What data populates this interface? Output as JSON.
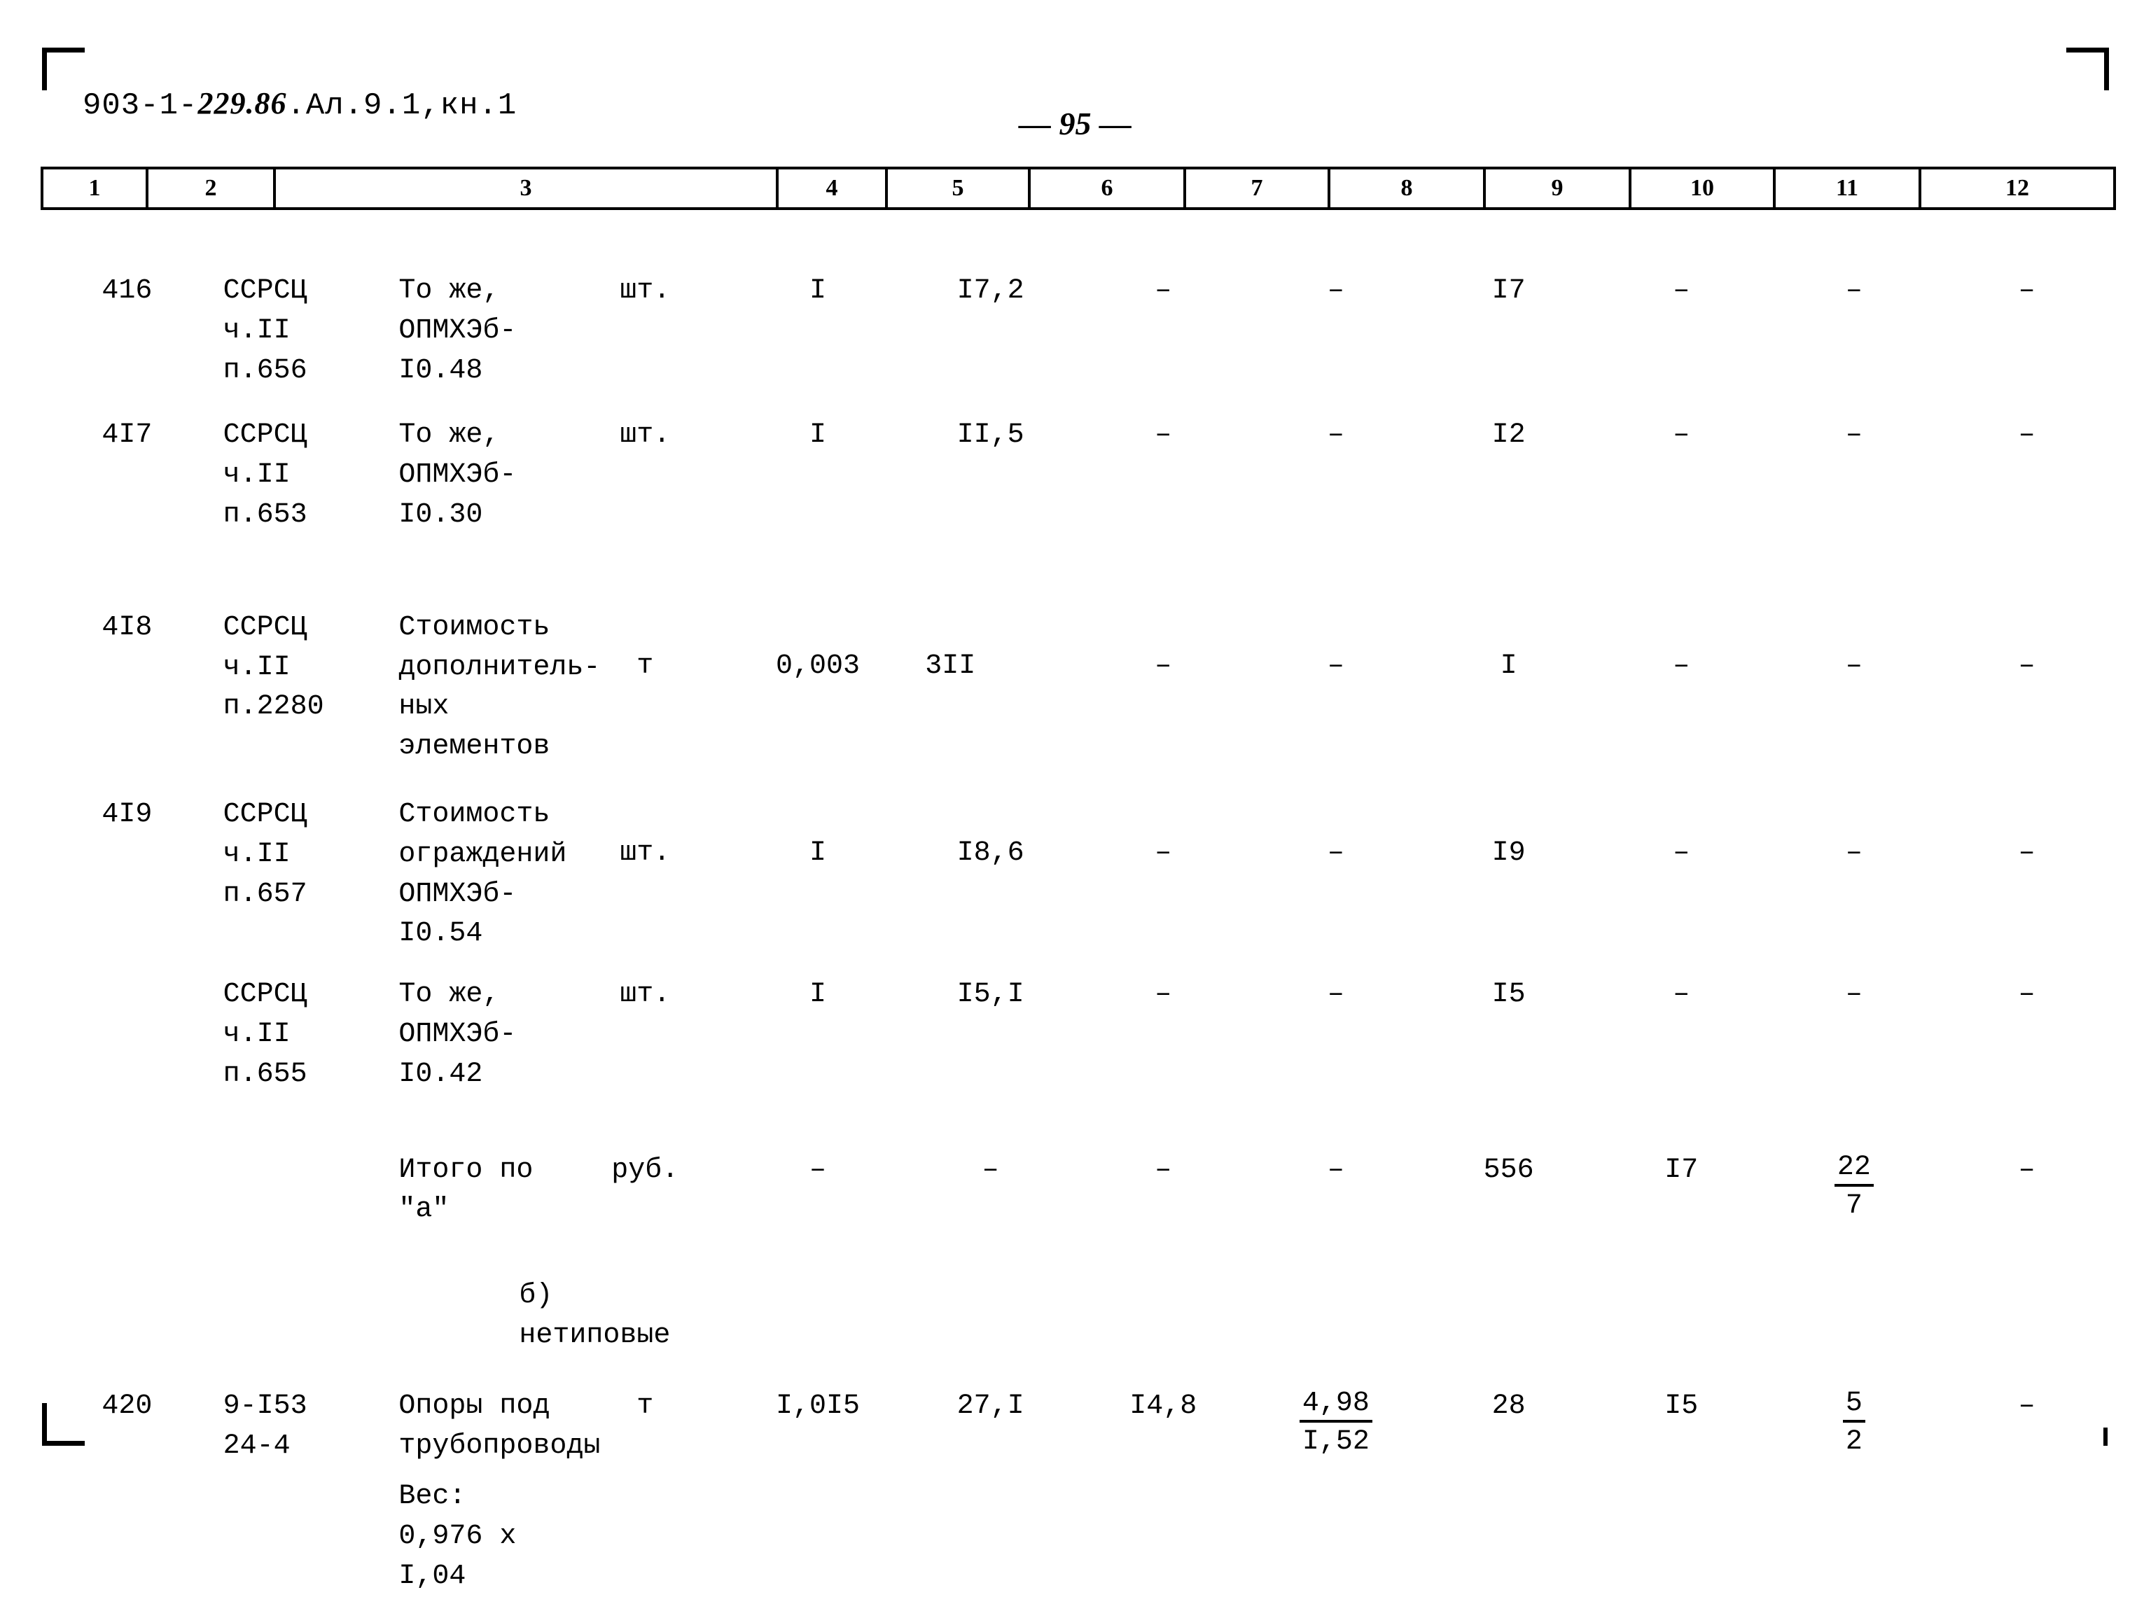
{
  "header": {
    "doc_code_prefix": "903-1-",
    "doc_code_italic": "229.86",
    "doc_code_suffix": ".Ал.9.1,кн.1",
    "page_number": "— 95 —"
  },
  "table": {
    "column_headers": [
      "1",
      "2",
      "3",
      "4",
      "5",
      "6",
      "7",
      "8",
      "9",
      "10",
      "11",
      "12"
    ],
    "rows": [
      {
        "num": "416",
        "code": "ССРСЦ\nч.II\nп.656",
        "name": "То же, ОПМХЭб-I0.48",
        "unit": "шт.",
        "c5": "I",
        "c6": "I7,2",
        "c7": "–",
        "c8": "–",
        "c9": "I7",
        "c10": "–",
        "c11": "–",
        "c12": "–"
      },
      {
        "num": "4I7",
        "code": "ССРСЦ\nч.II\nп.653",
        "name": "То же, ОПМХЭб-I0.30",
        "unit": "шт.",
        "c5": "I",
        "c6": "II,5",
        "c7": "–",
        "c8": "–",
        "c9": "I2",
        "c10": "–",
        "c11": "–",
        "c12": "–"
      },
      {
        "num": "4I8",
        "code": "ССРСЦ\nч.II\nп.2280",
        "name": "Стоимость дополнитель-\nных элементов",
        "unit": "т",
        "c5": "0,003",
        "c6": "3II",
        "c7": "–",
        "c8": "–",
        "c9": "I",
        "c10": "–",
        "c11": "–",
        "c12": "–"
      },
      {
        "num": "4I9",
        "code": "ССРСЦ\nч.II\nп.657",
        "name": "Стоимость ограждений\nОПМХЭб-I0.54",
        "unit": "шт.",
        "c5": "I",
        "c6": "I8,6",
        "c7": "–",
        "c8": "–",
        "c9": "I9",
        "c10": "–",
        "c11": "–",
        "c12": "–"
      },
      {
        "num": "",
        "code": "ССРСЦ\nч.II\nп.655",
        "name": "То же, ОПМХЭб-I0.42",
        "unit": "шт.",
        "c5": "I",
        "c6": "I5,I",
        "c7": "–",
        "c8": "–",
        "c9": "I5",
        "c10": "–",
        "c11": "–",
        "c12": "–"
      }
    ],
    "total_row": {
      "label": "Итого по \"а\"",
      "unit": "руб.",
      "c5": "–",
      "c6": "–",
      "c7": "–",
      "c8": "–",
      "c9": "556",
      "c10": "I7",
      "c11_numerator": "22",
      "c11_denominator": "7",
      "c12": "–"
    },
    "subheading": "б) нетиповые",
    "row_420": {
      "num": "420",
      "code": "9-I53\n24-4",
      "name": "Опоры под трубопроводы",
      "unit": "т",
      "c5": "I,0I5",
      "c6": "27,I",
      "c7": "I4,8",
      "c8_numerator": "4,98",
      "c8_denominator": "I,52",
      "c9": "28",
      "c10": "I5",
      "c11_numerator": "5",
      "c11_denominator": "2",
      "c12": "–"
    },
    "weight_note": "Вес: 0,976 х I,04"
  }
}
